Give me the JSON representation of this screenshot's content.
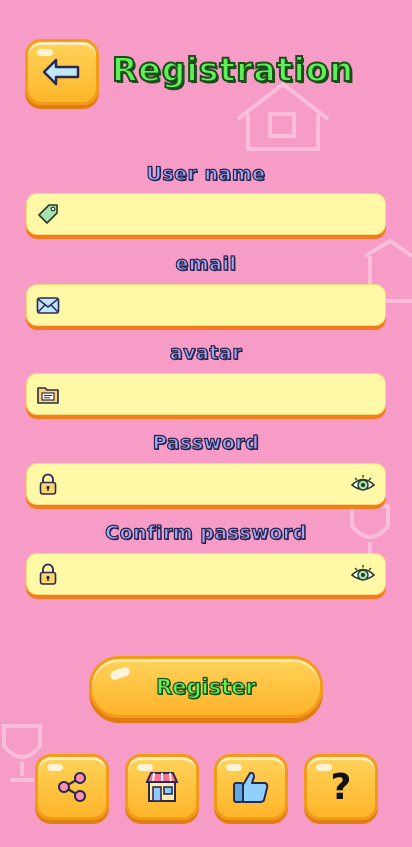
{
  "header": {
    "title": "Registration"
  },
  "form": {
    "username": {
      "label": "User name",
      "value": ""
    },
    "email": {
      "label": "email",
      "value": ""
    },
    "avatar": {
      "label": "avatar",
      "value": ""
    },
    "password": {
      "label": "Password",
      "value": ""
    },
    "confirm": {
      "label": "Confirm password",
      "value": ""
    }
  },
  "register": {
    "label": "Register"
  },
  "bottom_nav": {
    "share_icon": "share-icon",
    "shop_icon": "shop-icon",
    "like_icon": "thumbs-up-icon",
    "help_label": "?"
  },
  "colors": {
    "background": "#f79cc6",
    "field": "#fff8a6",
    "button": "#ffc13a",
    "accent_green": "#5ff05a"
  }
}
